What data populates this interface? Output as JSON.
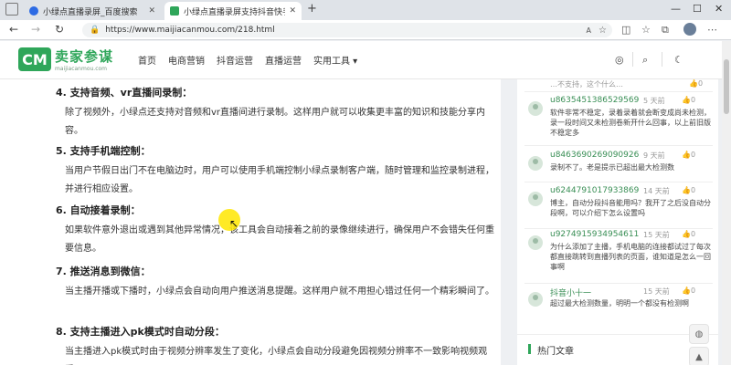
{
  "browser": {
    "tabs": [
      {
        "title": "小绿点直播录屏_百度搜索",
        "active": false
      },
      {
        "title": "小绿点直播录屏支持抖音快手直…",
        "active": true
      }
    ],
    "url": "https://www.maijiacanmou.com/218.html",
    "reader_label": "A"
  },
  "site": {
    "logo_mark": "CM",
    "logo_cn": "卖家参谋",
    "logo_en": "maijiacanmou.com",
    "nav": [
      "首页",
      "电商营销",
      "抖音运营",
      "直播运营",
      "实用工具 ▾"
    ],
    "brand_color": "#2fa65a"
  },
  "article": {
    "sections": [
      {
        "heading": "4. 支持音频、vr直播间录制：",
        "body": "除了视频外，小绿点还支持对音频和vr直播间进行录制。这样用户就可以收集更丰富的知识和技能分享内容。"
      },
      {
        "heading": "5. 支持手机端控制：",
        "body": "当用户节假日出门不在电脑边时，用户可以使用手机端控制小绿点录制客户端，随时管理和监控录制进程，并进行相应设置。"
      },
      {
        "heading": "6. 自动接着录制：",
        "body": "如果软件意外退出或遇到其他异常情况，该工具会自动接着之前的录像继续进行，确保用户不会错失任何重要信息。"
      },
      {
        "heading": "7. 推送消息到微信：",
        "body": "当主播开播或下播时，小绿点会自动向用户推送消息提醒。这样用户就不用担心错过任何一个精彩瞬间了。"
      },
      {
        "heading": "8. 支持主播进入pk模式时自动分段：",
        "body": "当主播进入pk模式时由于视频分辨率发生了变化，小绿点会自动分段避免因视频分辨率不一致影响视频观看。"
      }
    ]
  },
  "sidebar": {
    "top_text": "…不支持，这个什么…",
    "top_like": "0",
    "comments": [
      {
        "user": "u8635451386529569",
        "time": "5 天前",
        "likes": "0",
        "text": "软件非常不稳定，录着录着就会断变成尚未检测，录一段时间又未检测卷新开什么回事，以上前旧版不稳定多"
      },
      {
        "user": "u8463690269090926",
        "time": "9 天前",
        "likes": "0",
        "text": "录制不了。老是提示已超出最大检测数"
      },
      {
        "user": "u6244791017933869",
        "time": "14 天前",
        "likes": "0",
        "text": "博主，自动分段抖音能用吗？我开了之后没自动分段啊，可以介绍下怎么设置吗"
      },
      {
        "user": "u9274915934954611",
        "time": "15 天前",
        "likes": "0",
        "text": "为什么添加了主播，手机电脑的连接都试过了每次都直接跳转到直播列表的页面，谁知道是怎么一回事啊"
      },
      {
        "user": "抖音小十一",
        "time": "15 天前",
        "likes": "0",
        "text": "超过最大检测数量，明明一个都没有检测啊"
      }
    ],
    "hot_title": "热门文章"
  }
}
